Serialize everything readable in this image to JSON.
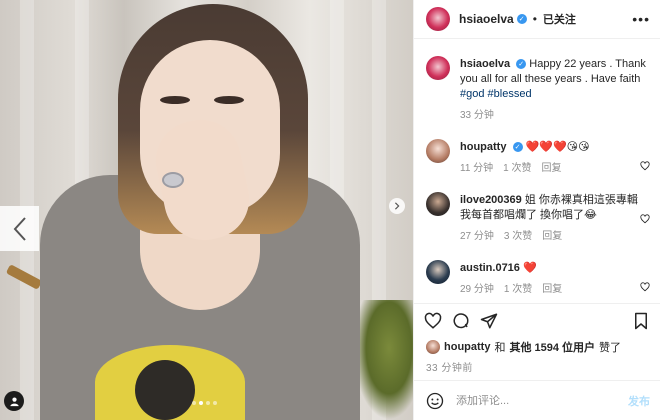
{
  "post": {
    "username": "hsiaoelva",
    "follow_status": "已关注",
    "separator": "•",
    "more_icon": "more-horizontal-icon",
    "caption": {
      "text": "Happy 22 years . Thank you all for all these years . Have faith",
      "tags": [
        "#god",
        "#blessed"
      ],
      "time": "33 分钟"
    },
    "image": {
      "slide_count": 4,
      "active_slide": 3
    }
  },
  "comments": [
    {
      "username": "houpatty",
      "verified": true,
      "text": "❤️❤️❤️😘😘",
      "time": "11 分钟",
      "likes": "1 次赞",
      "reply": "回复"
    },
    {
      "username": "ilove200369",
      "verified": false,
      "text": "姐 你赤裸真相這張專輯 我每首都唱爛了 換你唱了😂",
      "time": "27 分钟",
      "likes": "3 次赞",
      "reply": "回复"
    },
    {
      "username": "austin.0716",
      "verified": false,
      "text": "❤️",
      "time": "29 分钟",
      "likes": "1 次赞",
      "reply": "回复"
    }
  ],
  "likes": {
    "liker": "houpatty",
    "connector": "和",
    "others": "其他 1594 位用户",
    "suffix": "赞了"
  },
  "posted_time": "33 分钟前",
  "add_comment": {
    "placeholder": "添加评论...",
    "post_label": "发布"
  },
  "colors": {
    "link": "#003569",
    "verified": "#3897f0",
    "post_button_disabled": "#b2dffc",
    "meta_text": "#8e8e8e",
    "heart_red": "#ed4956"
  },
  "icons": [
    "heart-icon",
    "comment-icon",
    "share-icon",
    "bookmark-icon",
    "emoji-icon",
    "chevron-left-icon",
    "chevron-right-icon",
    "user-tag-icon"
  ]
}
